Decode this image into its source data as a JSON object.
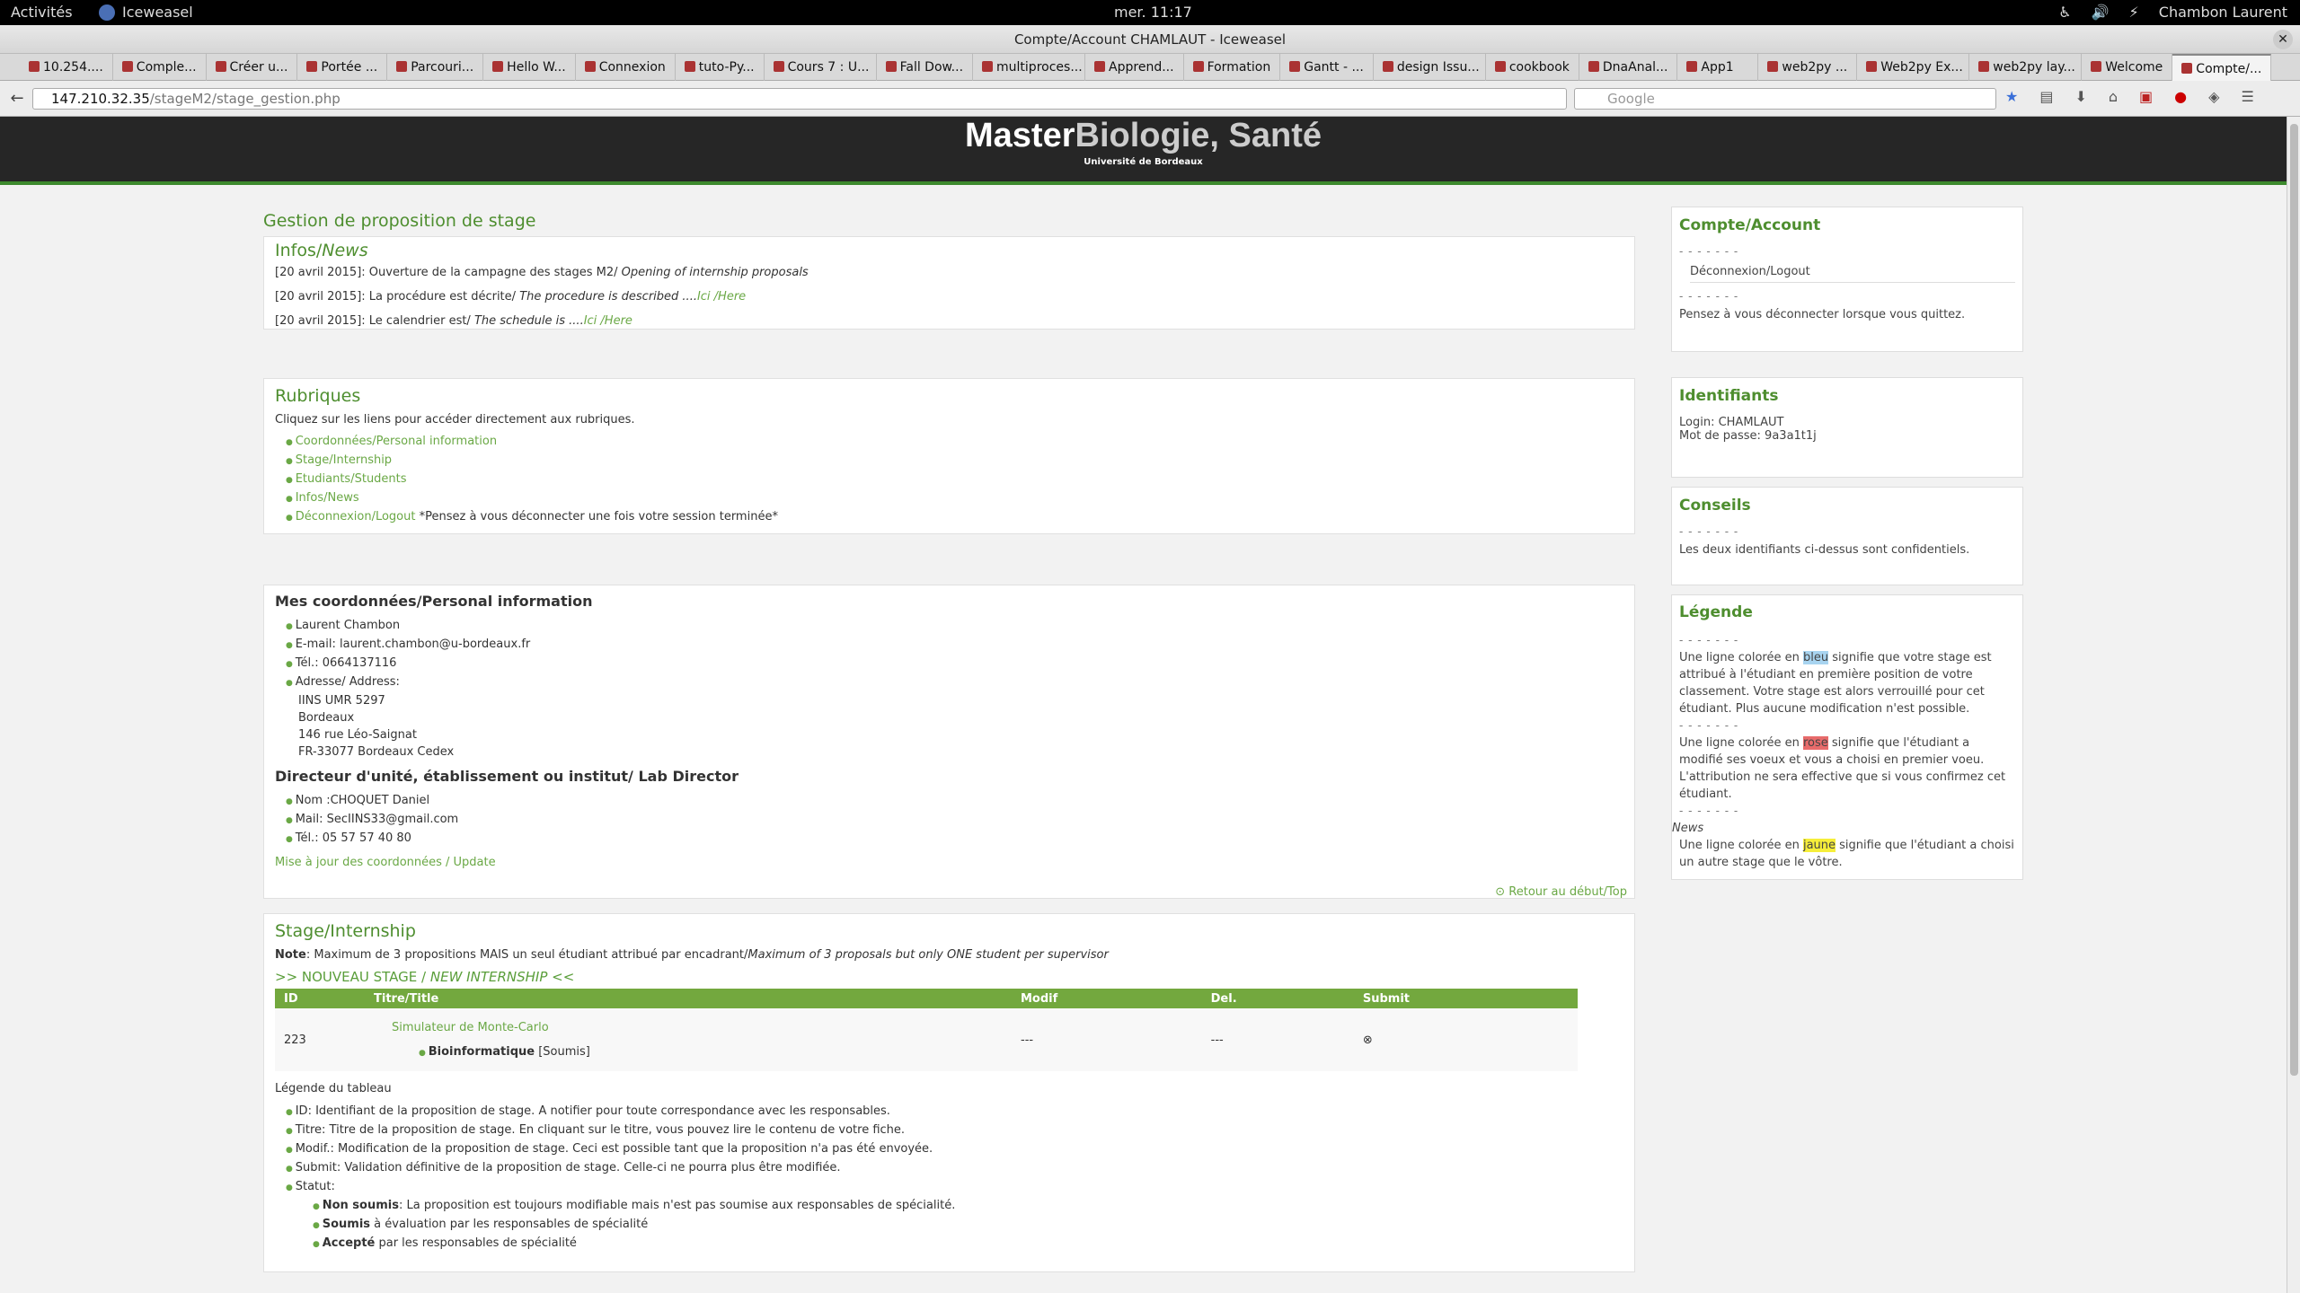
{
  "system": {
    "activities": "Activités",
    "app_name": "Iceweasel",
    "clock": "mer. 11:17",
    "user": "Chambon Laurent"
  },
  "window": {
    "title": "Compte/Account CHAMLAUT - Iceweasel"
  },
  "tabs": [
    "10.254....",
    "Comple...",
    "Créer u...",
    "Portée ...",
    "Parcouri...",
    "Hello W...",
    "Connexion",
    "tuto-Py...",
    "Cours 7 : U...",
    "Fall Dow...",
    "multiproces...",
    "Apprend...",
    "Formation",
    "Gantt - ...",
    "design Issu...",
    "cookbook",
    "DnaAnal...",
    "App1",
    "web2py ...",
    "Web2py Ex...",
    "web2py lay...",
    "Welcome",
    "Compte/..."
  ],
  "url": {
    "host": "147.210.32.35",
    "path": "/stageM2/stage_gestion.php",
    "search_placeholder": "Google"
  },
  "site": {
    "brand1": "Master",
    "brand2": "Biologie, Santé",
    "subtitle": "Université de Bordeaux"
  },
  "main": {
    "page_title": "Gestion de proposition de stage",
    "infos_title": "Infos/",
    "infos_title_en": "News",
    "news": [
      {
        "date": "[20 avril 2015]: Ouverture de la campagne des stages M2/ ",
        "en": "Opening of internship proposals",
        "link": ""
      },
      {
        "date": "[20 avril 2015]: La procédure est décrite/ ",
        "en": "The procedure is described ....",
        "link": "Ici /Here"
      },
      {
        "date": "[20 avril 2015]: Le calendrier est/ ",
        "en": "The schedule is ....",
        "link": "Ici /Here"
      }
    ],
    "rubriques_title": "Rubriques",
    "rubriques_intro": "Cliquez sur les liens pour accéder directement aux rubriques.",
    "rubriques": [
      "Coordonnées/Personal information",
      "Stage/Internship",
      "Etudiants/Students",
      "Infos/News",
      "Déconnexion/Logout"
    ],
    "rubriques_note": " *Pensez à vous déconnecter une fois votre session terminée*",
    "coord_title": "Mes coordonnées/Personal information",
    "coord": [
      "Laurent Chambon",
      "E-mail: laurent.chambon@u-bordeaux.fr",
      "Tél.: 0664137116",
      "Adresse/ Address:"
    ],
    "address": [
      "IINS UMR 5297",
      "Bordeaux",
      "146 rue Léo-Saignat",
      "FR-33077 Bordeaux Cedex"
    ],
    "director_title": "Directeur d'unité, établissement ou institut/ Lab Director",
    "director": [
      "Nom :CHOQUET Daniel",
      "Mail: SecIINS33@gmail.com",
      "Tél.: 05 57 57 40 80"
    ],
    "update": "Mise à jour des coordonnées / Update",
    "top": "Retour au début/Top",
    "stage_title": "Stage/Internship",
    "note_label": "Note",
    "note": ": Maximum de 3 propositions MAIS un seul étudiant attribué par encadrant/",
    "note_en": "Maximum of 3 proposals but only ONE student per supervisor",
    "new_stage": ">> NOUVEAU STAGE / ",
    "new_stage_en": "NEW INTERNSHIP <<",
    "table_headers": [
      "ID",
      "Titre/Title",
      "Modif",
      "Del.",
      "Submit"
    ],
    "row": {
      "id": "223",
      "title": "Simulateur de Monte-Carlo",
      "spec": "Bioinformatique",
      "status": "[Soumis]",
      "modif": "---",
      "del": "---",
      "submit": "⊗"
    },
    "legend_title": "Légende du tableau",
    "legend": [
      "ID: Identifiant de la proposition de stage. A notifier pour toute correspondance avec les responsables.",
      "Titre: Titre de la proposition de stage. En cliquant sur le titre, vous pouvez lire le contenu de votre fiche.",
      "Modif.: Modification de la proposition de stage. Ceci est possible tant que la proposition n'a pas été envoyée.",
      "Submit: Validation définitive de la proposition de stage. Celle-ci ne pourra plus être modifiée.",
      "Statut:"
    ],
    "statut": [
      {
        "b": "Non soumis",
        "t": ": La proposition est toujours modifiable mais n'est pas soumise aux responsables de spécialité."
      },
      {
        "b": "Soumis",
        "t": " à évaluation par les responsables de spécialité"
      },
      {
        "b": "Accepté",
        "t": " par les responsables de spécialité"
      }
    ]
  },
  "sidebar": {
    "account_title": "Compte/Account",
    "dashes": "- - - - - - -",
    "logout": "Déconnexion/Logout",
    "logout_note": "Pensez à vous déconnecter lorsque vous quittez.",
    "id_title": "Identifiants",
    "login": "Login: CHAMLAUT",
    "password": "Mot de passe: 9a3a1t1j",
    "conseils_title": "Conseils",
    "conseils": "Les deux identifiants ci-dessus sont confidentiels.",
    "legende_title": "Légende",
    "l1a": "Une ligne colorée en ",
    "l1b": "bleu",
    "l1c": " signifie que votre stage est attribué à l'étudiant en première position de votre classement. Votre stage est alors verrouillé pour cet étudiant. Plus aucune modification n'est possible.",
    "l2a": "Une ligne colorée en ",
    "l2b": "rose",
    "l2c": " signifie que l'étudiant a modifié ses voeux et vous a choisi en premier voeu. L'attribution ne sera effective que si vous confirmez cet étudiant.",
    "news": "News",
    "l3a": "Une ligne colorée en ",
    "l3b": "jaune",
    "l3c": " signifie que l'étudiant a choisi un autre stage que le vôtre."
  }
}
